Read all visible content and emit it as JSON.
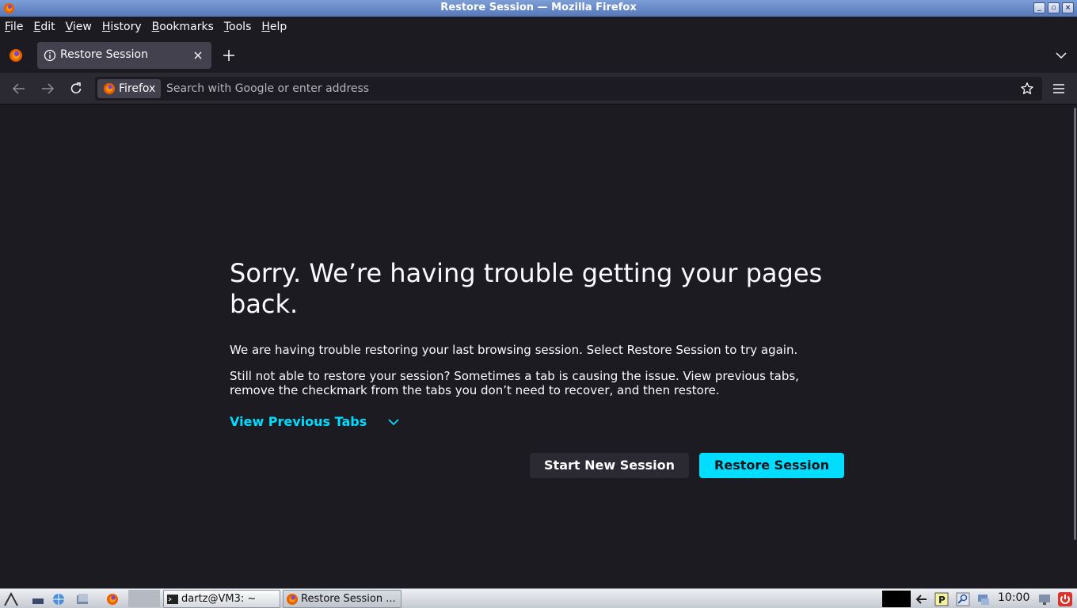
{
  "window": {
    "title": "Restore Session — Mozilla Firefox"
  },
  "menubar": [
    "File",
    "Edit",
    "View",
    "History",
    "Bookmarks",
    "Tools",
    "Help"
  ],
  "tabs": [
    {
      "label": "Restore Session",
      "active": true
    }
  ],
  "urlbar": {
    "identity_label": "Firefox",
    "placeholder": "Search with Google or enter address",
    "value": ""
  },
  "page": {
    "heading": "Sorry. We’re having trouble getting your pages back.",
    "para1": "We are having trouble restoring your last browsing session. Select Restore Session to try again.",
    "para2": "Still not able to restore your session? Sometimes a tab is causing the issue. View previous tabs, remove the checkmark from the tabs you don’t need to recover, and then restore.",
    "view_previous_tabs": "View Previous Tabs",
    "start_new_session": "Start New Session",
    "restore_session": "Restore Session"
  },
  "taskbar": {
    "tasks": [
      {
        "label": "dartz@VM3: ~",
        "icon": "terminal-icon"
      },
      {
        "label": "Restore Session ...",
        "icon": "firefox-icon"
      }
    ],
    "clock": "10:00"
  },
  "colors": {
    "accent": "#00ddff",
    "background": "#1c1b22",
    "toolbar": "#2b2a33"
  }
}
